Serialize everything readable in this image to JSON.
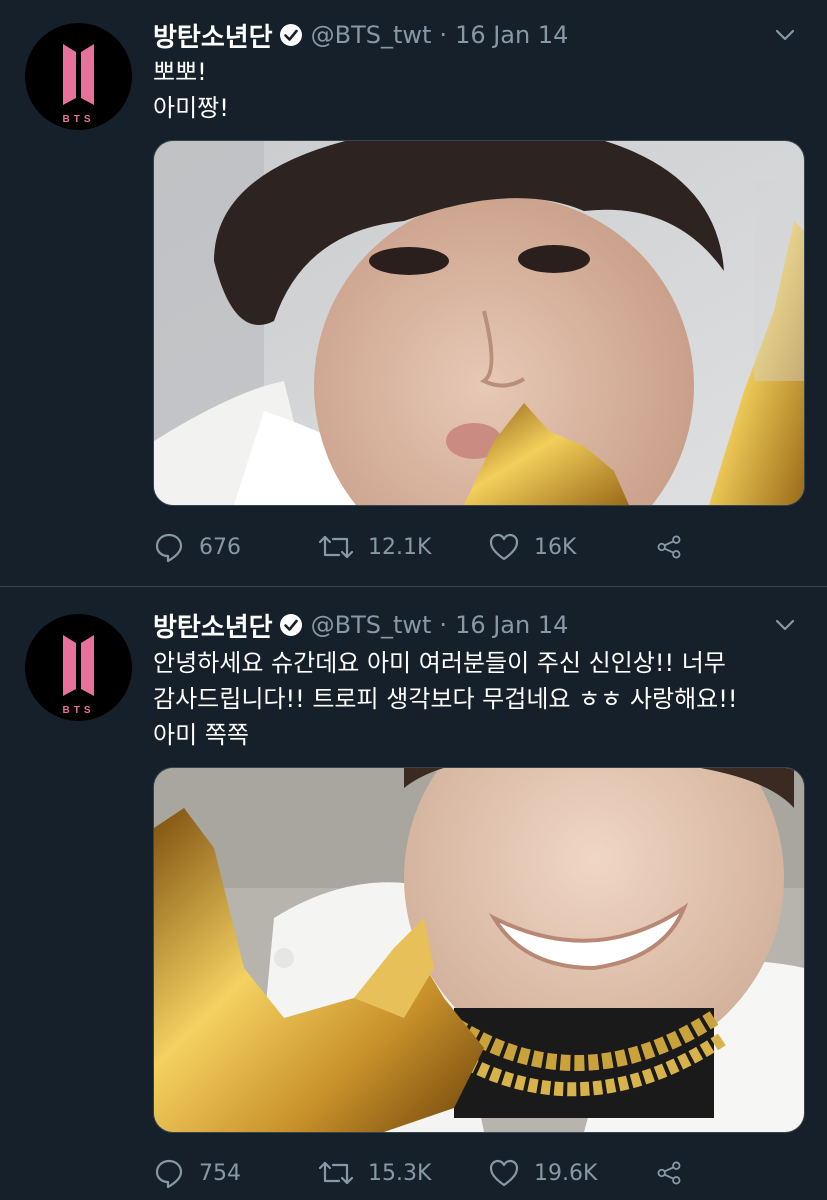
{
  "colors": {
    "background": "#15202b",
    "divider": "#38444d",
    "secondary_text": "#8899a6",
    "brand_pink": "#e8719c"
  },
  "avatar_logo_text": "BTS",
  "tweets": [
    {
      "display_name": "방탄소년단",
      "verified": true,
      "handle": "@BTS_twt",
      "separator": "·",
      "date": "16 Jan 14",
      "lines": [
        "뽀뽀!",
        "아미짱!"
      ],
      "media": "photo",
      "stats": {
        "replies": "676",
        "retweets": "12.1K",
        "likes": "16K"
      },
      "icons": [
        "reply-icon",
        "retweet-icon",
        "like-icon",
        "share-icon"
      ]
    },
    {
      "display_name": "방탄소년단",
      "verified": true,
      "handle": "@BTS_twt",
      "separator": "·",
      "date": "16 Jan 14",
      "lines": [
        "안녕하세요 슈간데요 아미 여러분들이 주신 신인상!! 너무",
        "감사드립니다!! 트로피 생각보다 무겁네요 ㅎㅎ 사랑해요!!",
        "아미 쪽쪽"
      ],
      "media": "photo",
      "stats": {
        "replies": "754",
        "retweets": "15.3K",
        "likes": "19.6K"
      },
      "icons": [
        "reply-icon",
        "retweet-icon",
        "like-icon",
        "share-icon"
      ]
    }
  ]
}
